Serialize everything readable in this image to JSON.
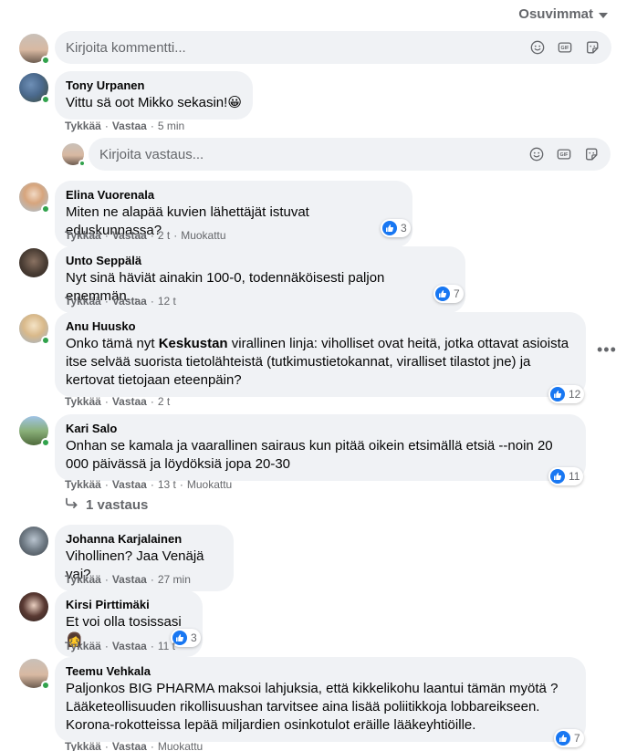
{
  "sort": {
    "label": "Osuvimmat"
  },
  "composer": {
    "placeholder": "Kirjoita kommentti..."
  },
  "reply_composer": {
    "placeholder": "Kirjoita vastaus..."
  },
  "actions": {
    "like": "Tykkää",
    "reply": "Vastaa",
    "sep": "·"
  },
  "replies_link": {
    "label": "1 vastaus"
  },
  "comments": [
    {
      "name": "Tony Urpanen",
      "text": "Vittu sä oot Mikko sekasin!",
      "emoji": "😀",
      "time": "5 min",
      "edited": "",
      "reactions": ""
    },
    {
      "name": "Elina Vuorenala",
      "text": "Miten ne alapää kuvien lähettäjät istuvat eduskunnassa?",
      "time": "2 t",
      "edited": "Muokattu",
      "reactions": "3"
    },
    {
      "name": "Unto Seppälä",
      "text": "Nyt sinä häviät ainakin 100-0, todennäköisesti paljon enemmän...",
      "time": "12 t",
      "edited": "",
      "reactions": "7"
    },
    {
      "name": "Anu Huusko",
      "text_a": "Onko tämä nyt ",
      "text_bold": "Keskustan",
      "text_b": " virallinen linja: viholliset ovat heitä, jotka ottavat asioista itse selvää suorista tietolähteistä (tutkimustietokannat, viralliset tilastot jne) ja kertovat tietojaan eteenpäin?",
      "time": "2 t",
      "edited": "",
      "reactions": "12"
    },
    {
      "name": "Kari Salo",
      "text": "Onhan se kamala ja vaarallinen sairaus kun pitää oikein etsimällä etsiä --noin 20 000 päivässä ja löydöksiä jopa 20-30",
      "time": "13 t",
      "edited": "Muokattu",
      "reactions": "11"
    },
    {
      "name": "Johanna Karjalainen",
      "text": "Vihollinen? Jaa Venäjä vai?",
      "time": "27 min",
      "edited": "",
      "reactions": ""
    },
    {
      "name": "Kirsi Pirttimäki",
      "text": "Et voi olla tosissasi",
      "emoji": "👩",
      "time": "11 t",
      "edited": "",
      "reactions": "3"
    },
    {
      "name": "Teemu Vehkala",
      "text": "Paljonkos BIG PHARMA maksoi lahjuksia, että kikkelikohu laantui tämän myötä ? Lääketeollisuuden rikollisuushan tarvitsee aina lisää poliitikkoja lobbareikseen. Korona-rokotteissa lepää miljardien osinkotulot eräille lääkeyhtiöille.",
      "time": "",
      "edited": "Muokattu",
      "reactions": "7"
    }
  ],
  "colors": {
    "bubble": "#f0f2f5",
    "secondary_text": "#65676b",
    "like_blue": "#1877f2",
    "online_green": "#31a24c"
  }
}
